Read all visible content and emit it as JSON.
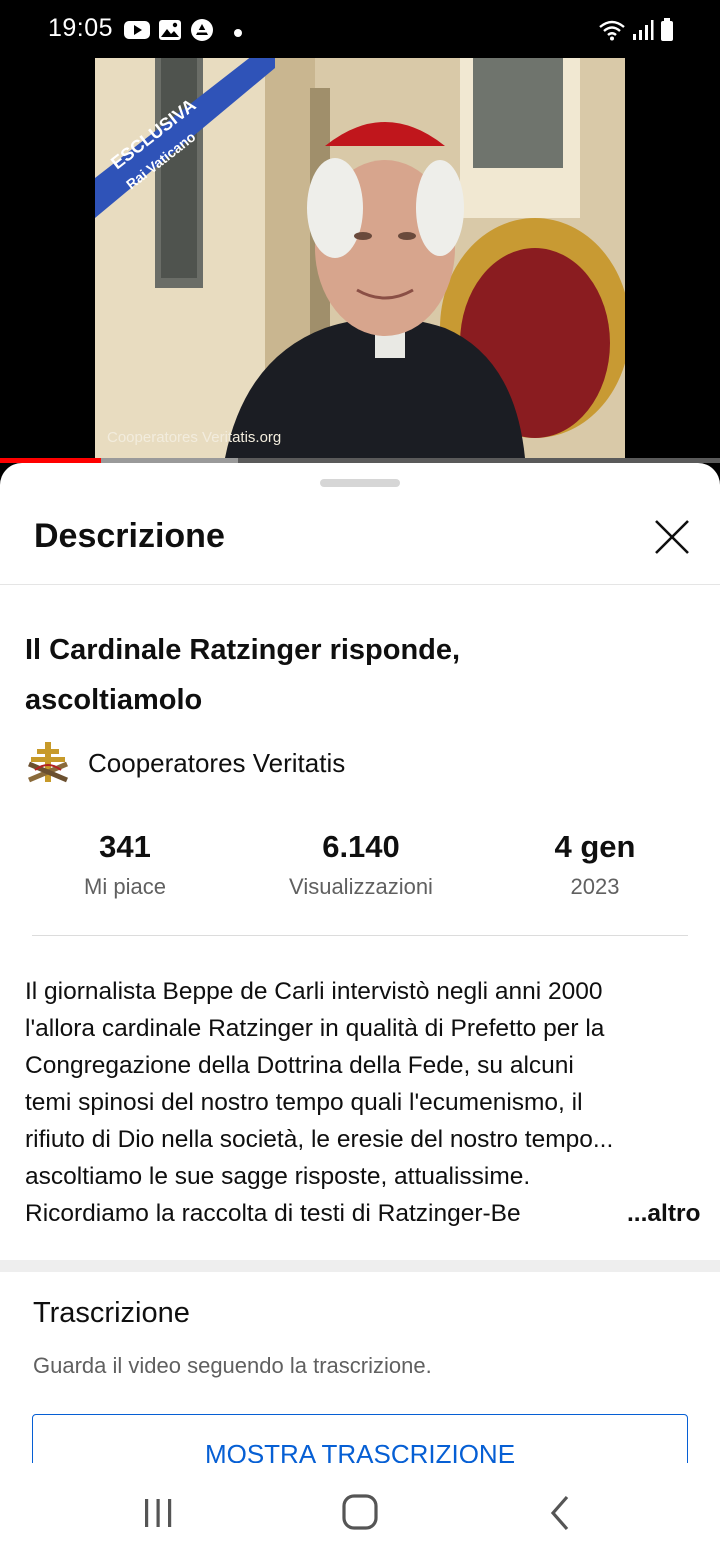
{
  "status_bar": {
    "time": "19:05",
    "left_icons": [
      "youtube-icon",
      "gallery-icon",
      "app-icon",
      "notification-dot"
    ],
    "right_icons": [
      "wifi-icon",
      "signal-icon",
      "battery-icon"
    ]
  },
  "video": {
    "overlay_banner": "ESCLUSIVA",
    "overlay_banner_sub": "Rai Vaticano",
    "watermark": "Cooperatores Veritatis.org",
    "progress_fraction": 0.14,
    "buffer_fraction": 0.33
  },
  "sheet": {
    "title": "Descrizione",
    "close_icon": "close-icon"
  },
  "video_title": "Il Cardinale Ratzinger risponde, ascoltiamolo",
  "channel": {
    "name": "Cooperatores Veritatis",
    "avatar_icon": "channel-cross-icon"
  },
  "stats": [
    {
      "value": "341",
      "label": "Mi piace"
    },
    {
      "value": "6.140",
      "label": "Visualizzazioni"
    },
    {
      "value": "4 gen",
      "label": "2023"
    }
  ],
  "description": {
    "lines": [
      "Il giornalista Beppe de Carli intervistò negli anni 2000",
      "l'allora cardinale Ratzinger in qualità di Prefetto per la",
      "Congregazione della Dottrina della Fede, su alcuni",
      "temi spinosi del nostro tempo quali l'ecumenismo, il",
      "rifiuto di Dio nella società, le eresie del nostro tempo...",
      "ascoltiamo le sue sagge risposte, attualissime.",
      "Ricordiamo la raccolta di testi di Ratzinger-Be"
    ],
    "more_label": "...altro"
  },
  "transcript": {
    "title": "Trascrizione",
    "subtitle": "Guarda il video seguendo la trascrizione.",
    "button_label": "MOSTRA TRASCRIZIONE"
  },
  "nav_bar": {
    "buttons": [
      "recents-icon",
      "home-icon",
      "back-icon"
    ]
  },
  "colors": {
    "accent_blue": "#065fd4",
    "progress_red": "#ff0000",
    "text_primary": "#0f0f0f",
    "text_secondary": "#606060"
  }
}
